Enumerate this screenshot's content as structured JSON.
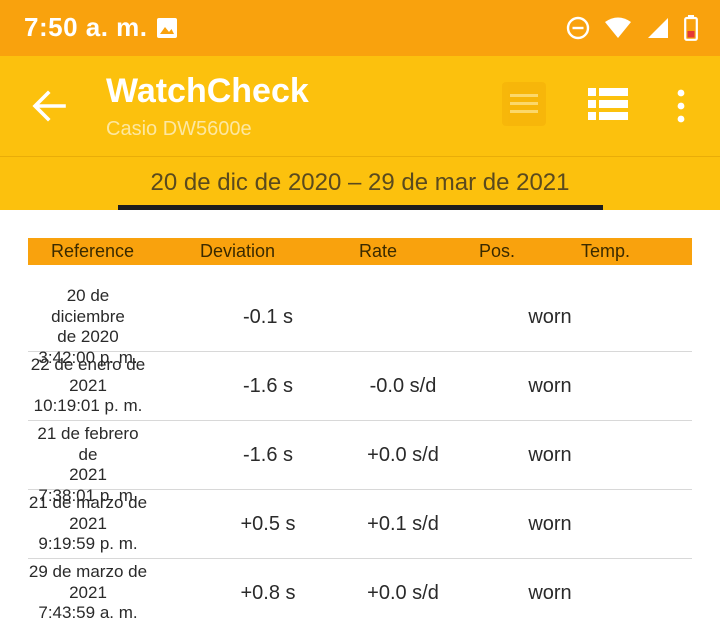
{
  "status_bar": {
    "time": "7:50 a. m.",
    "icons": [
      "image-icon",
      "do-not-disturb-icon",
      "wifi-icon",
      "signal-icon",
      "battery-low-icon"
    ]
  },
  "app_bar": {
    "title": "WatchCheck",
    "subtitle": "Casio DW5600e",
    "icons": [
      "back-arrow-icon",
      "chart-icon",
      "list-icon",
      "more-vert-icon"
    ]
  },
  "range": {
    "label": "20 de dic de 2020 – 29 de mar de 2021"
  },
  "table": {
    "headers": {
      "reference": "Reference",
      "deviation": "Deviation",
      "rate": "Rate",
      "pos": "Pos.",
      "temp": "Temp."
    },
    "rows": [
      {
        "ref_line1": "20 de diciembre",
        "ref_line2": "de 2020",
        "ref_line3": "3:42:00 p. m.",
        "deviation": "-0.1 s",
        "rate": "",
        "pos": "worn",
        "temp": ""
      },
      {
        "ref_line1": "22 de enero de",
        "ref_line2": "2021",
        "ref_line3": "10:19:01 p. m.",
        "deviation": "-1.6 s",
        "rate": "-0.0 s/d",
        "pos": "worn",
        "temp": ""
      },
      {
        "ref_line1": "21 de febrero de",
        "ref_line2": "2021",
        "ref_line3": "7:38:01 p. m.",
        "deviation": "-1.6 s",
        "rate": "+0.0 s/d",
        "pos": "worn",
        "temp": ""
      },
      {
        "ref_line1": "21 de marzo de",
        "ref_line2": "2021",
        "ref_line3": "9:19:59 p. m.",
        "deviation": "+0.5 s",
        "rate": "+0.1 s/d",
        "pos": "worn",
        "temp": ""
      },
      {
        "ref_line1": "29 de marzo de",
        "ref_line2": "2021",
        "ref_line3": "7:43:59 a. m.",
        "deviation": "+0.8 s",
        "rate": "+0.0 s/d",
        "pos": "worn",
        "temp": ""
      }
    ]
  },
  "colors": {
    "status_bar": "#f9a20d",
    "app_bar": "#fcc10d",
    "header_row": "#f9a20d",
    "indicator": "#1d1d1d"
  }
}
